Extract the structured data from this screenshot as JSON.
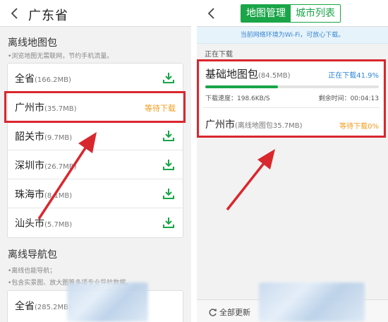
{
  "left": {
    "header_title": "广东省",
    "offline_maps": {
      "title": "离线地图包",
      "subtitle": "•浏览地图无需联网，节约手机流量。",
      "rows": [
        {
          "name": "全省",
          "size": "(166.2MB)",
          "status": ""
        },
        {
          "name": "广州市",
          "size": "(35.7MB)",
          "status": "等待下载"
        },
        {
          "name": "韶关市",
          "size": "(9.7MB)",
          "status": ""
        },
        {
          "name": "深圳市",
          "size": "(26.7MB)",
          "status": ""
        },
        {
          "name": "珠海市",
          "size": "(8.1MB)",
          "status": ""
        },
        {
          "name": "汕头市",
          "size": "(5.7MB)",
          "status": ""
        }
      ]
    },
    "offline_nav": {
      "title": "离线导航包",
      "subtitle_1": "•离线也能导航；",
      "subtitle_2": "•包含实景图、放大图等多项专业导航数据。",
      "rows": [
        {
          "name": "全省",
          "size": "(285.2MB)"
        }
      ]
    }
  },
  "right": {
    "tabs": [
      "地图管理",
      "城市列表"
    ],
    "active_tab": 0,
    "notice": "当前网络环境为Wi-Fi，可放心下载。",
    "downloading_label": "正在下载",
    "item1": {
      "name": "基础地图包",
      "size": "(84.5MB)",
      "status": "正在下载41.9%",
      "progress": 0.419,
      "speed": "下载速度：198.6KB/S",
      "remaining": "剩余时间：00:04:13"
    },
    "item2": {
      "name": "广州市",
      "size": "(离线地图包35.7MB)",
      "status": "等待下载0%"
    },
    "update_all": "全部更新"
  },
  "colors": {
    "accent_green": "#1aa548",
    "waiting_orange": "#f29b1d",
    "downloading_blue": "#2f86d6",
    "highlight_red": "#d9272e"
  }
}
